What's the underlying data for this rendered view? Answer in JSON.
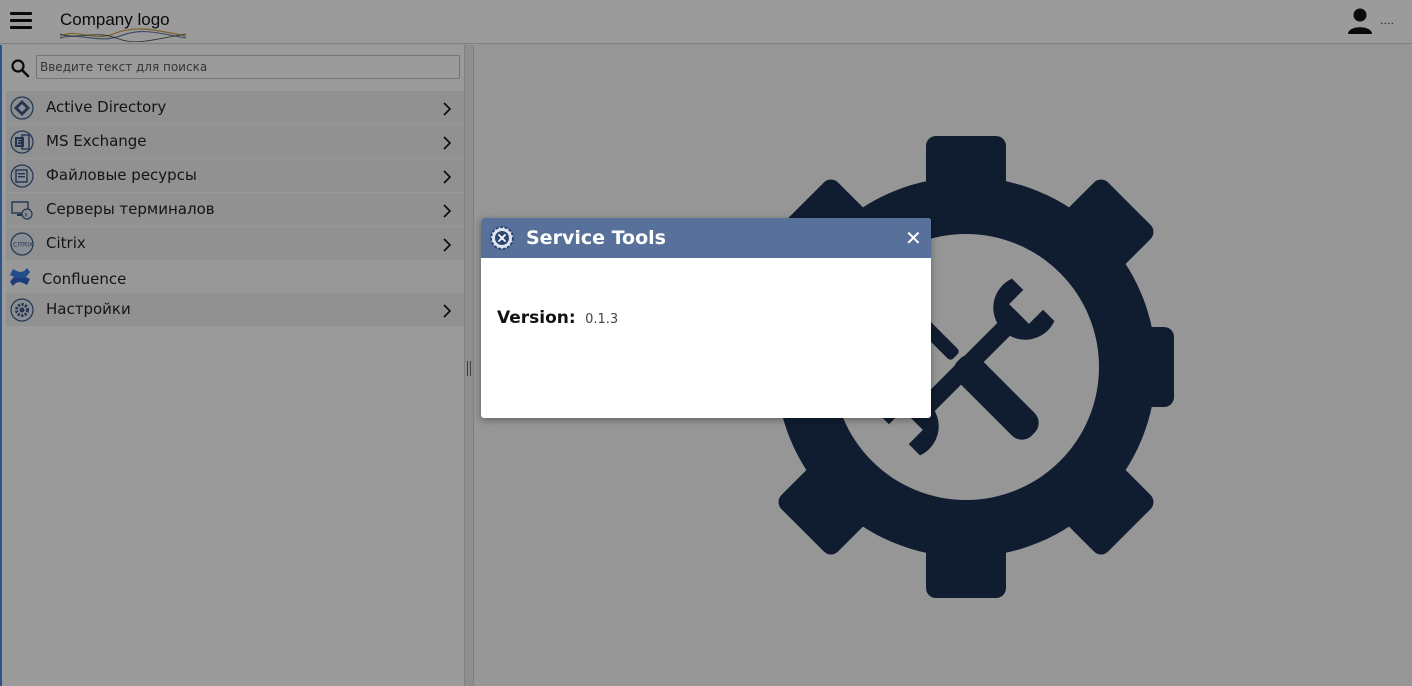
{
  "header": {
    "logo_text": "Company logo",
    "user_name": "...."
  },
  "sidebar": {
    "search_placeholder": "Введите текст для поиска",
    "items": [
      {
        "label": "Active Directory",
        "icon": "active-directory-icon",
        "has_children": true
      },
      {
        "label": "MS Exchange",
        "icon": "ms-exchange-icon",
        "has_children": true
      },
      {
        "label": "Файловые ресурсы",
        "icon": "file-resources-icon",
        "has_children": true
      },
      {
        "label": "Серверы терминалов",
        "icon": "terminal-servers-icon",
        "has_children": true
      },
      {
        "label": "Citrix",
        "icon": "citrix-icon",
        "has_children": true
      },
      {
        "label": "Confluence",
        "icon": "confluence-icon",
        "has_children": false
      },
      {
        "label": "Настройки",
        "icon": "settings-gear-icon",
        "has_children": true
      }
    ]
  },
  "dialog": {
    "title": "Service Tools",
    "close_symbol": "✕",
    "version_label": "Version:",
    "version_value": "0.1.3"
  },
  "colors": {
    "dialog_header": "#58719a",
    "gear": "#1b2f4e",
    "sidebar_accent": "#4a8ad8"
  }
}
